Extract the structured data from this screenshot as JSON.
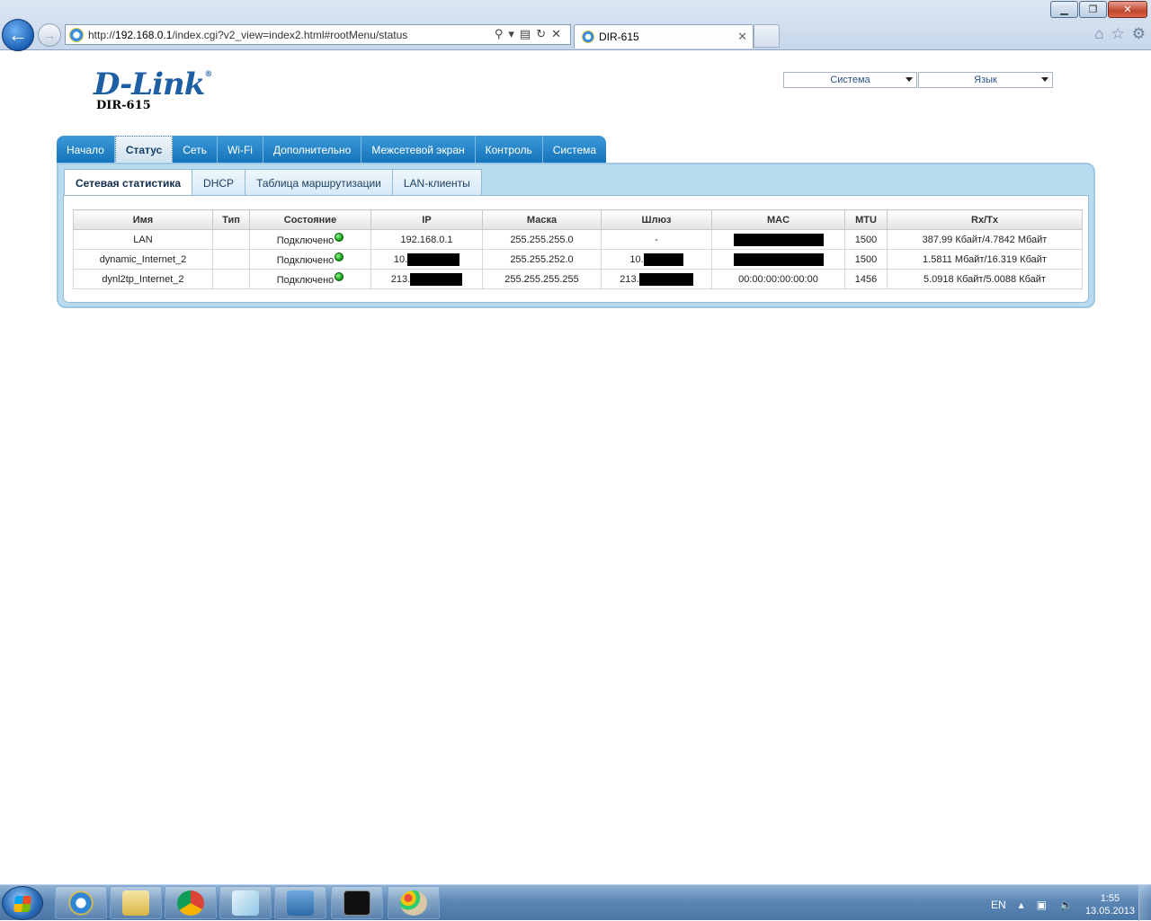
{
  "browser": {
    "url_prefix": "http://",
    "url_host": "192.168.0.1",
    "url_path": "/index.cgi?v2_view=index2.html#rootMenu/status",
    "tab_title": "DIR-615",
    "tab_close": "✕"
  },
  "header": {
    "logo": "D-Link",
    "model": "DIR-615",
    "system_select": "Система",
    "language_select": "Язык"
  },
  "main_nav": [
    {
      "label": "Начало"
    },
    {
      "label": "Статус",
      "active": true
    },
    {
      "label": "Сеть"
    },
    {
      "label": "Wi-Fi"
    },
    {
      "label": "Дополнительно"
    },
    {
      "label": "Межсетевой экран"
    },
    {
      "label": "Контроль"
    },
    {
      "label": "Система"
    }
  ],
  "sub_nav": [
    {
      "label": "Сетевая статистика",
      "active": true
    },
    {
      "label": "DHCP"
    },
    {
      "label": "Таблица маршрутизации"
    },
    {
      "label": "LAN-клиенты"
    }
  ],
  "table": {
    "headers": [
      "Имя",
      "Тип",
      "Состояние",
      "IP",
      "Маска",
      "Шлюз",
      "MAC",
      "MTU",
      "Rx/Tx"
    ],
    "rows": [
      {
        "name": "LAN",
        "type": "",
        "state": "Подключено",
        "ip": "192.168.0.1",
        "mask": "255.255.255.0",
        "gateway": "-",
        "mac": "",
        "mtu": "1500",
        "rxtx": "387.99 Кбайт/4.7842 Мбайт"
      },
      {
        "name": "dynamic_Internet_2",
        "type": "",
        "state": "Подключено",
        "ip": "10.",
        "mask": "255.255.252.0",
        "gateway": "10.",
        "mac": "",
        "mtu": "1500",
        "rxtx": "1.5811 Мбайт/16.319 Кбайт"
      },
      {
        "name": "dynl2tp_Internet_2",
        "type": "",
        "state": "Подключено",
        "ip": "213.",
        "mask": "255.255.255.255",
        "gateway": "213.",
        "mac": "00:00:00:00:00:00",
        "mtu": "1456",
        "rxtx": "5.0918 Кбайт/5.0088 Кбайт"
      }
    ]
  },
  "taskbar": {
    "language": "EN",
    "time": "1:55",
    "date": "13.05.2013"
  }
}
